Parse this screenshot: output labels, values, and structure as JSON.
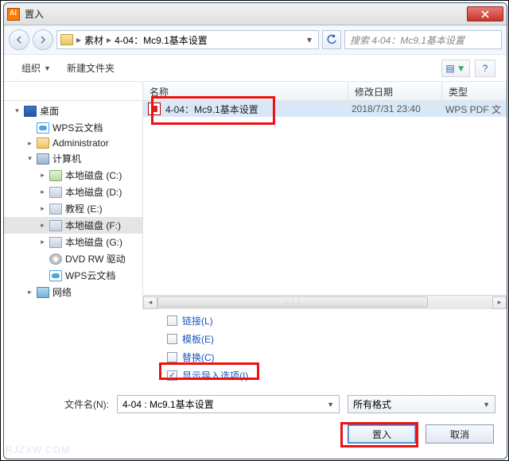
{
  "title": "置入",
  "nav": {
    "breadcrumb1": "素材",
    "breadcrumb2": "4-04：Mc9.1基本设置",
    "search_placeholder": "搜索 4-04：Mc9.1基本设置"
  },
  "toolbar": {
    "organize": "组织",
    "new_folder": "新建文件夹"
  },
  "columns": {
    "name": "名称",
    "date": "修改日期",
    "type": "类型"
  },
  "tree": {
    "desktop": "桌面",
    "wps_cloud": "WPS云文档",
    "administrator": "Administrator",
    "computer": "计算机",
    "drive_c": "本地磁盘 (C:)",
    "drive_d": "本地磁盘 (D:)",
    "drive_e": "教程 (E:)",
    "drive_f": "本地磁盘 (F:)",
    "drive_g": "本地磁盘 (G:)",
    "dvd": "DVD RW 驱动",
    "wps_cloud2": "WPS云文档",
    "network": "网络"
  },
  "file": {
    "name": "4-04：Mc9.1基本设置",
    "date": "2018/7/31 23:40",
    "type": "WPS PDF 文"
  },
  "options": {
    "link": "链接(L)",
    "template": "模板(E)",
    "replace": "替换(C)",
    "show_import": "显示导入选项(I)"
  },
  "filename_label": "文件名(N):",
  "filename_value": "4-04 : Mc9.1基本设置",
  "format": "所有格式",
  "buttons": {
    "place": "置入",
    "cancel": "取消"
  },
  "watermark": "RJZXW.COM"
}
